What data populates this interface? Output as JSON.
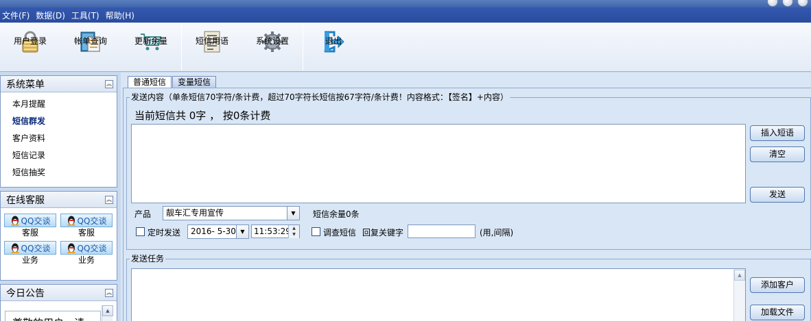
{
  "menu": [
    {
      "label": "文件(F)"
    },
    {
      "label": "数据(D)"
    },
    {
      "label": "工具(T)"
    },
    {
      "label": "帮助(H)"
    }
  ],
  "toolbar": {
    "login": {
      "label": "用户登录",
      "icon": "lock-icon"
    },
    "account": {
      "label": "帐单查询",
      "icon": "ledger-icon"
    },
    "balance": {
      "label": "更新余量",
      "icon": "cart-icon"
    },
    "phrases": {
      "label": "短信用语",
      "icon": "document-icon"
    },
    "settings": {
      "label": "系统设置",
      "icon": "gear-icon"
    },
    "exit": {
      "label": "退出",
      "icon": "exit-icon"
    }
  },
  "sidebar": {
    "menu_title": "系统菜单",
    "items": [
      {
        "label": "本月提醒"
      },
      {
        "label": "短信群发"
      },
      {
        "label": "客户资料"
      },
      {
        "label": "短信记录"
      },
      {
        "label": "短信抽奖"
      }
    ],
    "active_index": 1,
    "support_title": "在线客服",
    "support": [
      {
        "button": "QQ交谈",
        "label": "客服"
      },
      {
        "button": "QQ交谈",
        "label": "客服"
      },
      {
        "button": "QQ交谈",
        "label": "业务"
      },
      {
        "button": "QQ交谈",
        "label": "业务"
      }
    ],
    "notice_title": "今日公告",
    "notice_text": "尊敬的用户，请"
  },
  "main": {
    "tabs": [
      {
        "label": "普通短信",
        "active": true
      },
      {
        "label": "变量短信",
        "active": false
      }
    ],
    "content_legend": "发送内容（单条短信70字符/条计费，超过70字符长短信按67字符/条计费！内容格式：【签名】+内容）",
    "count_text": "当前短信共  0字 ， 按0条计费",
    "message_value": "",
    "buttons": {
      "insert": "插入短语",
      "clear": "清空",
      "send": "发送",
      "add_customer": "添加客户",
      "load_file": "加载文件"
    },
    "product_label": "产品",
    "product_value": "靓车汇专用宣传",
    "balance_text": "短信余量0条",
    "schedule_label": "定时发送",
    "schedule_checked": false,
    "date_value": "2016- 5-30",
    "time_value": "11:53:29",
    "survey_label": "调查短信",
    "survey_checked": false,
    "reply_label": "回复关键字",
    "reply_value": "",
    "reply_hint": "(用,间隔)",
    "task_legend": "发送任务"
  },
  "colors": {
    "menubar": "#2f52a6",
    "panel_border": "#7e99c6",
    "main_bg": "#d9e6f5",
    "qq_blue": "#1c5aa8"
  }
}
